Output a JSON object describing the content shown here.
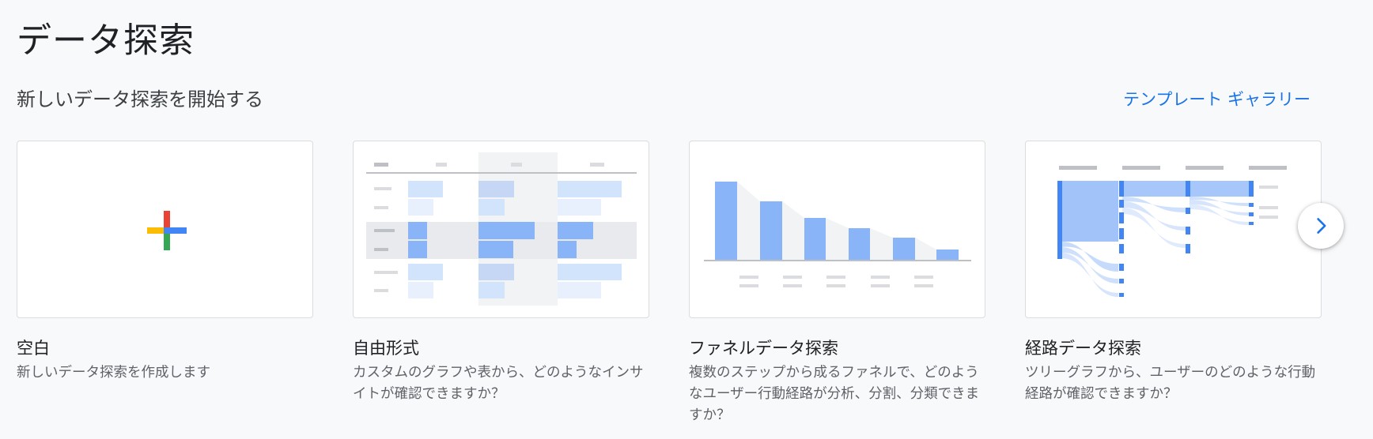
{
  "page": {
    "title": "データ探索",
    "section_title": "新しいデータ探索を開始する",
    "gallery_link": "テンプレート ギャラリー"
  },
  "cards": [
    {
      "title": "空白",
      "description": "新しいデータ探索を作成します",
      "icon": "plus-icon"
    },
    {
      "title": "自由形式",
      "description": "カスタムのグラフや表から、どのようなインサイトが確認できますか？",
      "icon": "free-form-table-thumbnail"
    },
    {
      "title": "ファネルデータ探索",
      "description": "複数のステップから成るファネルで、どのようなユーザー行動経路が分析、分割、分類できますか？",
      "icon": "funnel-chart-thumbnail"
    },
    {
      "title": "経路データ探索",
      "description": "ツリーグラフから、ユーザーのどのような行動経路が確認できますか？",
      "icon": "path-tree-thumbnail"
    }
  ],
  "next_button": {
    "icon": "chevron-right-icon"
  },
  "colors": {
    "accent": "#1a73e8",
    "bar_blue": "#8ab4f8",
    "bar_blue_dark": "#4285f4",
    "light_blue": "#d2e3fc",
    "google_red": "#ea4335",
    "google_blue": "#4285f4",
    "google_yellow": "#fbbc04",
    "google_green": "#34a853"
  }
}
